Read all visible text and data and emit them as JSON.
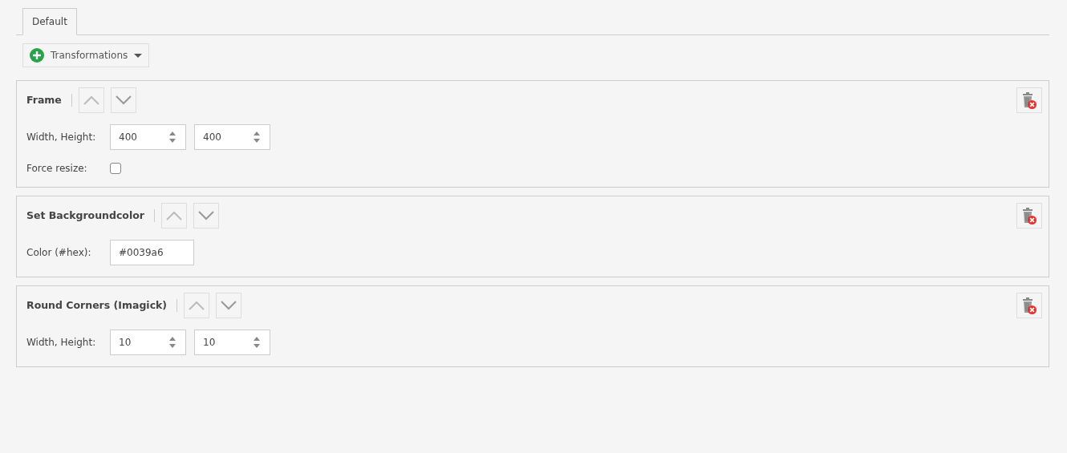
{
  "tabs": [
    {
      "label": "Default",
      "selected": true
    }
  ],
  "add_button": {
    "label": "Transformations"
  },
  "panels": [
    {
      "title": "Frame",
      "fields": [
        {
          "kind": "number_pair",
          "label": "Width, Height:",
          "values": [
            "400",
            "400"
          ]
        },
        {
          "kind": "checkbox",
          "label": "Force resize:",
          "checked": false
        }
      ]
    },
    {
      "title": "Set Backgroundcolor",
      "fields": [
        {
          "kind": "text",
          "label": "Color (#hex):",
          "value": "#0039a6"
        }
      ]
    },
    {
      "title": "Round Corners (Imagick)",
      "fields": [
        {
          "kind": "number_pair",
          "label": "Width, Height:",
          "values": [
            "10",
            "10"
          ]
        }
      ]
    }
  ]
}
